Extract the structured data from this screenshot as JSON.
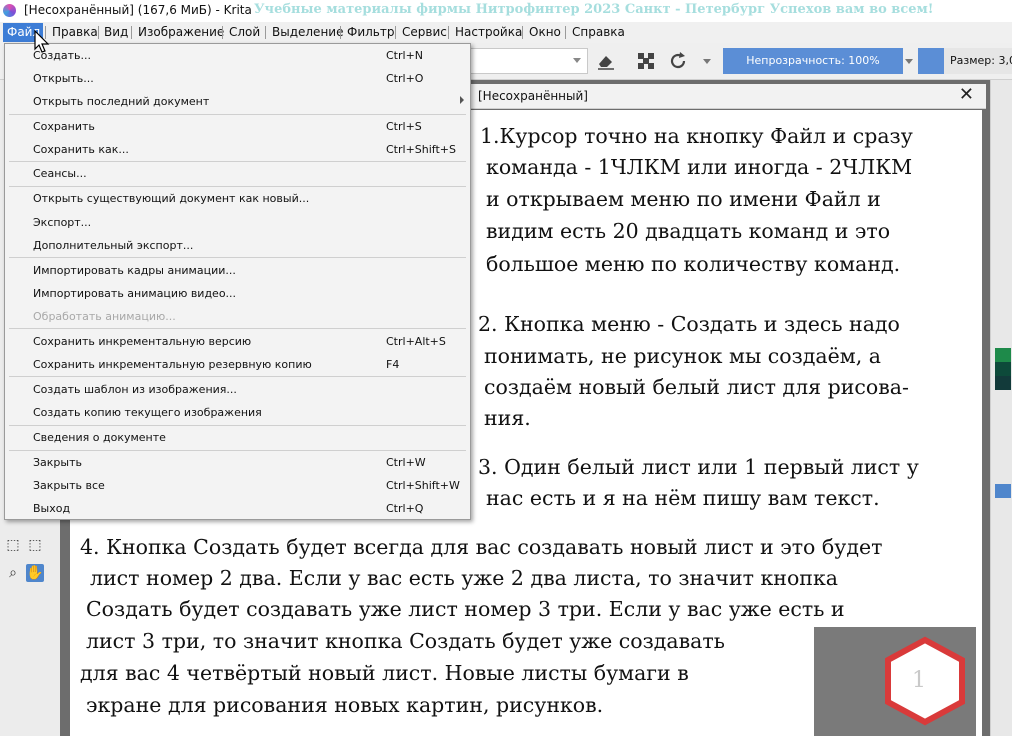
{
  "window": {
    "title": "[Несохранённый]  (167,6 МиБ)  - Krita",
    "watermark": "Учебные материалы фирмы Нитрофинтер 2023 Санкт - Петербург Успехов вам во всем!"
  },
  "menubar": {
    "items": [
      "Файл",
      "Правка",
      "Вид",
      "Изображение",
      "Слой",
      "Выделение",
      "Фильтр",
      "Сервис",
      "Настройка",
      "Окно",
      "Справка"
    ]
  },
  "toolbar": {
    "opacity_label": "Непрозрачность: 100%",
    "size_label": "Размер: 3,0",
    "accent_color": "#5b8ed6"
  },
  "file_menu": {
    "items": [
      {
        "label": "Создать...",
        "shortcut": "Ctrl+N"
      },
      {
        "label": "Открыть...",
        "shortcut": "Ctrl+O"
      },
      {
        "label": "Открыть последний документ",
        "shortcut": ""
      },
      {
        "label": "Сохранить",
        "shortcut": "Ctrl+S"
      },
      {
        "label": "Сохранить как...",
        "shortcut": "Ctrl+Shift+S"
      },
      {
        "label": "Сеансы...",
        "shortcut": ""
      },
      {
        "label": "Открыть существующий документ как новый...",
        "shortcut": ""
      },
      {
        "label": "Экспорт...",
        "shortcut": ""
      },
      {
        "label": "Дополнительный экспорт...",
        "shortcut": ""
      },
      {
        "label": "Импортировать кадры анимации...",
        "shortcut": ""
      },
      {
        "label": "Импортировать анимацию видео...",
        "shortcut": ""
      },
      {
        "label": "Обработать анимацию...",
        "shortcut": "",
        "disabled": true
      },
      {
        "label": "Сохранить инкрементальную версию",
        "shortcut": "Ctrl+Alt+S"
      },
      {
        "label": "Сохранить инкрементальную резервную копию",
        "shortcut": "F4"
      },
      {
        "label": "Создать шаблон из изображения...",
        "shortcut": ""
      },
      {
        "label": "Создать копию текущего изображения",
        "shortcut": ""
      },
      {
        "label": "Сведения о документе",
        "shortcut": ""
      },
      {
        "label": "Закрыть",
        "shortcut": "Ctrl+W"
      },
      {
        "label": "Закрыть все",
        "shortcut": "Ctrl+Shift+W"
      },
      {
        "label": "Выход",
        "shortcut": "Ctrl+Q"
      }
    ]
  },
  "document": {
    "tab_label": "[Несохранённый]",
    "lines": [
      "1.Курсор точно на кнопку Файл и сразу",
      "команда - 1ЧЛКМ или иногда - 2ЧЛКМ",
      "и открываем меню по имени Файл и",
      "видим есть 20 двадцать команд и это",
      "большое меню по количеству команд.",
      "2. Кнопка меню - Создать и здесь надо",
      "понимать, не рисунок мы создаём, а",
      "создаём новый белый лист для рисова-",
      "ния.",
      "3. Один белый лист или 1 первый лист у",
      "нас есть и я на нём пишу вам текст.",
      "4. Кнопка Создать будет всегда для вас создавать новый лист и это будет",
      "лист номер 2 два. Если у вас есть уже 2 два листа, то значит кнопка",
      "Создать будет создавать уже лист номер 3 три. Если у вас уже есть и",
      "лист 3 три, то значит кнопка Создать будет уже создавать",
      "для вас 4 четвёртый новый лист. Новые листы бумаги в",
      "экране для рисования новых картин, рисунков."
    ],
    "badge_number": "1",
    "badge_color": "#d93a3a"
  }
}
